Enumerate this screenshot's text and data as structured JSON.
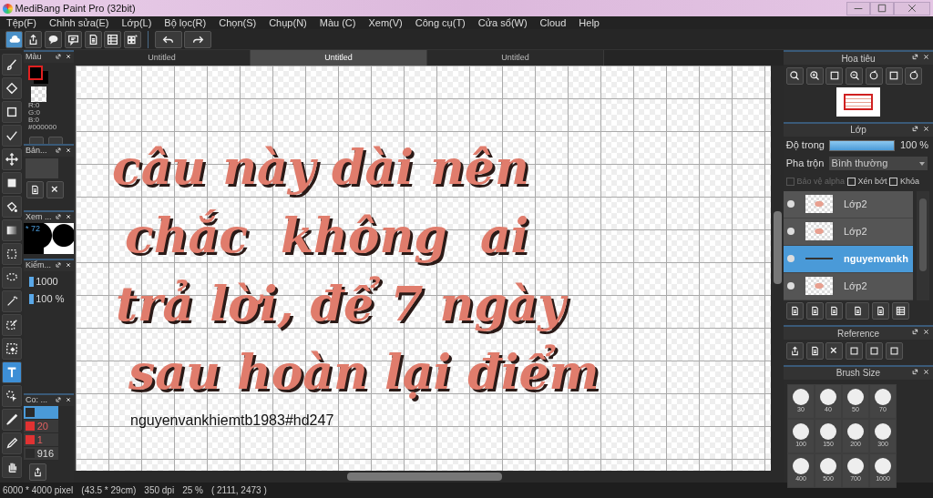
{
  "window": {
    "title": "MediBang Paint Pro (32bit)"
  },
  "menu": [
    "Tệp(F)",
    "Chỉnh sửa(E)",
    "Lớp(L)",
    "Bộ lọc(R)",
    "Chọn(S)",
    "Chụp(N)",
    "Màu (C)",
    "Xem(V)",
    "Công cụ(T)",
    "Cửa sổ(W)",
    "Cloud",
    "Help"
  ],
  "toolbar": [
    {
      "kind": "cloud",
      "selected": true
    },
    {
      "kind": "share",
      "selected": false
    },
    {
      "kind": "bubble",
      "selected": false
    },
    {
      "kind": "comment",
      "selected": false
    },
    {
      "kind": "page",
      "selected": false
    },
    {
      "kind": "list",
      "selected": false
    },
    {
      "kind": "grid",
      "selected": false
    },
    {
      "kind": "undo",
      "selected": false
    },
    {
      "kind": "redo",
      "selected": false
    }
  ],
  "tools": [
    {
      "kind": "brush",
      "selected": false
    },
    {
      "kind": "eraser",
      "selected": false
    },
    {
      "kind": "rect",
      "selected": false
    },
    {
      "kind": "polyline",
      "selected": false
    },
    {
      "kind": "move",
      "selected": false
    },
    {
      "kind": "square",
      "selected": false
    },
    {
      "kind": "bucket",
      "selected": false
    },
    {
      "kind": "gradient",
      "selected": false
    },
    {
      "kind": "selrect",
      "selected": false
    },
    {
      "kind": "lasso",
      "selected": false
    },
    {
      "kind": "wand",
      "selected": false
    },
    {
      "kind": "selpen",
      "selected": false
    },
    {
      "kind": "selerase",
      "selected": false
    },
    {
      "kind": "text",
      "selected": true
    },
    {
      "kind": "pointer",
      "selected": false
    },
    {
      "kind": "pen",
      "selected": false
    },
    {
      "kind": "dropper",
      "selected": false
    },
    {
      "kind": "hand",
      "selected": false
    }
  ],
  "color_panel": {
    "title": "Màu",
    "readout": [
      "R:0",
      "G:0",
      "B:0",
      "#000000"
    ]
  },
  "brush_panel": {
    "title": "Bản..."
  },
  "view_panel": {
    "title": "Xem ...",
    "zoom": "* 72"
  },
  "control_panel": {
    "title": "Kiểm...",
    "values": [
      "1000",
      "100 %"
    ]
  },
  "color_list_panel": {
    "title": "Co: ...",
    "items": [
      {
        "color": "#2a2a2a",
        "selected": true
      },
      {
        "label": "20",
        "color": "#e03232",
        "selected": false
      },
      {
        "label": "1",
        "color": "#e03232",
        "selected": false
      },
      {
        "label": "916",
        "color": "#2a2a2a",
        "selected": false
      }
    ]
  },
  "doc_tabs": [
    {
      "label": "Untitled",
      "selected": false
    },
    {
      "label": "Untitled",
      "selected": true
    },
    {
      "label": "Untitled",
      "selected": false
    }
  ],
  "canvas": {
    "lines": [
      "câu này dài nên",
      "chắc  không  ai",
      "trả lời, để 7 ngày",
      "sau hoàn lại điểm"
    ],
    "signature": "nguyenvankhiemtb1983#hd247"
  },
  "navigator": {
    "title": "Hoa tiêu"
  },
  "layers": {
    "title": "Lớp",
    "opacity_label": "Độ trong",
    "level": 1,
    "opacity_value": "100 %",
    "blend_label": "Pha trộn",
    "blend_value": "Bình thường",
    "options": [
      {
        "label": "Bảo vệ alpha",
        "checked": false,
        "disabled": true
      },
      {
        "label": "Xén bớt",
        "checked": false,
        "disabled": false
      },
      {
        "label": "Khóa",
        "checked": false,
        "disabled": false
      }
    ],
    "items": [
      {
        "name": "Lớp2",
        "kind": "raster",
        "selected": false
      },
      {
        "name": "Lớp2",
        "kind": "raster",
        "selected": false
      },
      {
        "name": "nguyenvankh",
        "kind": "text",
        "selected": true
      },
      {
        "name": "Lớp2",
        "kind": "raster",
        "selected": false
      }
    ]
  },
  "reference": {
    "title": "Reference"
  },
  "brush_size": {
    "title": "Brush Size",
    "sizes": [
      "30",
      "40",
      "50",
      "70",
      "100",
      "150",
      "200",
      "300",
      "400",
      "500",
      "700",
      "1000"
    ]
  },
  "status": [
    "6000 * 4000 pixel",
    "(43.5 * 29cm)",
    "350 dpi",
    "25 %",
    "( 2111, 2473 )"
  ]
}
